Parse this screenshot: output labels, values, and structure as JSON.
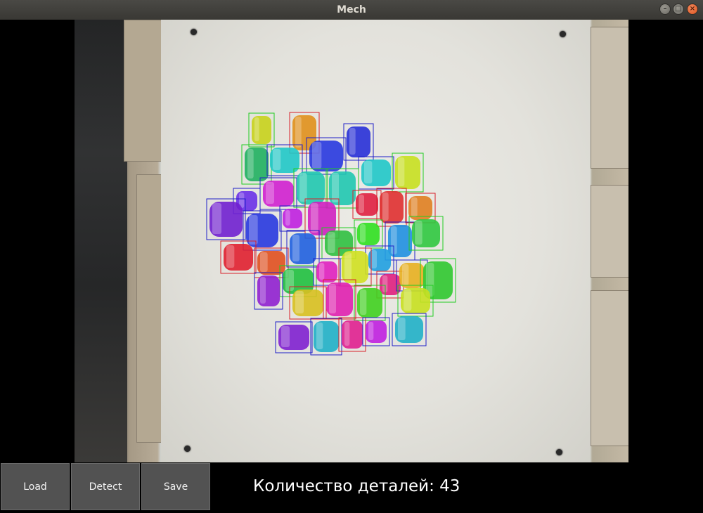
{
  "window": {
    "title": "Mech"
  },
  "buttons": {
    "load": "Load",
    "detect": "Detect",
    "save": "Save"
  },
  "status": {
    "count_text": "Количество деталей: 43"
  },
  "colors": {
    "titlebar": "#3c3b37",
    "close_button": "#e95420",
    "button_bg": "#525252",
    "window_bg": "#000000"
  },
  "icons": {
    "minimize": "minimize-icon",
    "maximize": "maximize-icon",
    "close": "close-icon"
  }
}
